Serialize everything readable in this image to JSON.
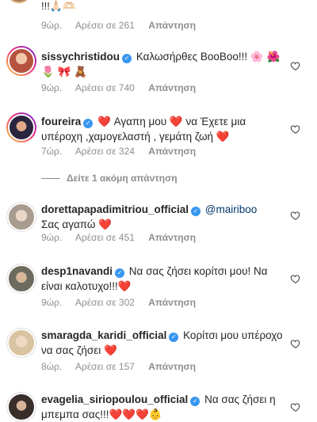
{
  "top_item": {
    "emoji_text": "!!!🙏🏻🫶🏻",
    "time": "9ώρ.",
    "likes": "Αρέσει σε 261",
    "reply": "Απάντηση"
  },
  "comments": [
    {
      "username": "sissychristidou",
      "verified": true,
      "text": "Καλωσήρθες BooBoo!!! 🌸 🌺 🌷 🎀 🧸",
      "time": "9ώρ.",
      "likes": "Αρέσει σε 740",
      "reply": "Απάντηση",
      "avatar_color": "#b4533f"
    },
    {
      "username": "foureira",
      "verified": true,
      "text": "❤️ Αγαπη μου ❤️ να Έχετε μια υπέροχη ,χαμογελαστή , γεμάτη ζωή ❤️",
      "time": "7ώρ.",
      "likes": "Αρέσει σε 324",
      "reply": "Απάντηση",
      "avatar_color": "#2b2540"
    },
    {
      "username": "dorettapapadimitriou_official",
      "verified": true,
      "mention": "@mairiboo",
      "text": "Σας αγαπώ ❤️",
      "time": "9ώρ.",
      "likes": "Αρέσει σε 451",
      "reply": "Απάντηση",
      "avatar_color": "#c8b9a6"
    },
    {
      "username": "desp1navandi",
      "verified": true,
      "text": "Να σας ζήσει κορίτσι μου! Να είναι καλοτυχο!!!❤️",
      "time": "9ώρ.",
      "likes": "Αρέσει σε 302",
      "reply": "Απάντηση",
      "avatar_color": "#6d6a5e"
    },
    {
      "username": "smaragda_karidi_official",
      "verified": true,
      "text": "Κορίτσι μου υπέροχο να σας ζήσει ❤️",
      "time": "8ώρ.",
      "likes": "Αρέσει σε 157",
      "reply": "Απάντηση",
      "avatar_color": "#d9c3a0"
    },
    {
      "username": "evagelia_siriopoulou_official",
      "verified": true,
      "text": "Να σας ζήσει η μπεμπα σας!!!❤️❤️❤️👶",
      "avatar_color": "#3a2e2b"
    }
  ],
  "more_replies": "Δείτε 1 ακόμη απάντηση",
  "colors": {
    "verified": "#3897f0",
    "meta_text": "#8e8e8e",
    "mention": "#00376b"
  }
}
